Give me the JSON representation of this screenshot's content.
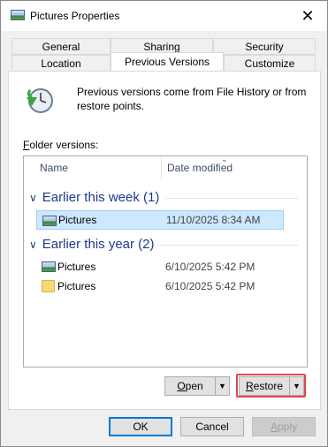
{
  "window": {
    "title": "Pictures Properties",
    "close_glyph": "✕"
  },
  "tabs": {
    "row1": [
      "General",
      "Sharing",
      "Security"
    ],
    "row2": [
      "Location",
      "Previous Versions",
      "Customize"
    ],
    "active": "Previous Versions"
  },
  "info": {
    "text": "Previous versions come from File History or from restore points."
  },
  "folder_versions": {
    "label_underlined": "F",
    "label_rest": "older versions:",
    "columns": {
      "name": "Name",
      "date": "Date modified"
    },
    "groups": [
      {
        "title": "Earlier this week (1)",
        "rows": [
          {
            "name": "Pictures",
            "date": "11/10/2025 8:34 AM",
            "icon": "pictures-library-icon",
            "selected": true
          }
        ]
      },
      {
        "title": "Earlier this year (2)",
        "rows": [
          {
            "name": "Pictures",
            "date": "6/10/2025 5:42 PM",
            "icon": "pictures-library-icon",
            "selected": false
          },
          {
            "name": "Pictures",
            "date": "6/10/2025 5:42 PM",
            "icon": "folder-icon",
            "selected": false
          }
        ]
      }
    ]
  },
  "buttons": {
    "open": {
      "underlined": "O",
      "rest": "pen"
    },
    "restore": {
      "underlined": "R",
      "rest": "estore"
    },
    "ok": "OK",
    "cancel": "Cancel",
    "apply_underlined": "A",
    "apply_rest": "pply"
  },
  "colors": {
    "accent": "#0078d7",
    "highlight": "#e04848",
    "selection": "#cde8ff",
    "group_text": "#1e3a8a"
  }
}
